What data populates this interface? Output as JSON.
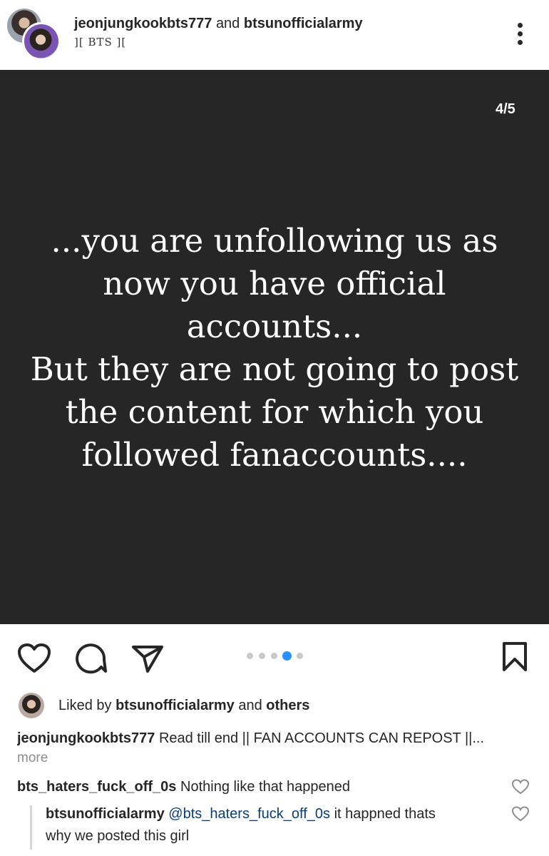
{
  "header": {
    "username_primary": "jeonjungkookbts777",
    "connector": "and",
    "username_secondary": "btsunofficialarmy",
    "subtitle": "][ BTS ]["
  },
  "post": {
    "counter": "4/5",
    "text": "...you are unfollowing us as\nnow you have official\naccounts...\nBut they are not going to post\nthe content for which you\nfollowed fanaccounts...."
  },
  "actions": {
    "icons": [
      "heart-icon",
      "comment-icon",
      "share-icon",
      "bookmark-icon"
    ],
    "carousel": {
      "total": 5,
      "active": 4
    },
    "accent_color": "#2a8fff"
  },
  "likes": {
    "prefix": "Liked by",
    "user": "btsunofficialarmy",
    "middle": "and",
    "others": "others"
  },
  "caption": {
    "user": "jeonjungkookbts777",
    "text": "Read till end || FAN ACCOUNTS CAN REPOST ||...",
    "more": "more"
  },
  "comments": [
    {
      "user": "bts_haters_fuck_off_0s",
      "text": "Nothing like that happened"
    },
    {
      "user": "btsunofficialarmy",
      "mention": "@bts_haters_fuck_off_0s",
      "text_line1": "it happned thats",
      "text_line2": "why we posted this girl"
    }
  ]
}
